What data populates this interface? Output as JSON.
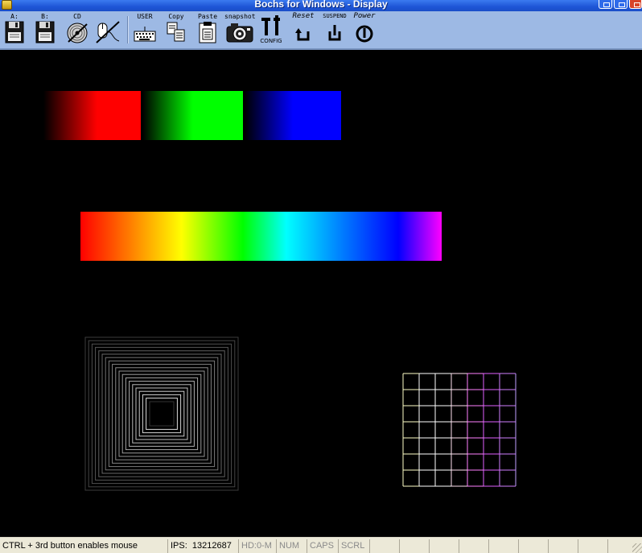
{
  "window": {
    "title": "Bochs for Windows - Display"
  },
  "toolbar": {
    "floppy_a": "A:",
    "floppy_b": "B:",
    "cdrom": "CD",
    "user": "USER",
    "copy": "Copy",
    "paste": "Paste",
    "snapshot": "snapshot",
    "config": "CONFIG",
    "reset": "Reset",
    "suspend": "SUSPEND",
    "power": "Power"
  },
  "display": {
    "fade_bars": [
      {
        "name": "red",
        "color": "#ff0000"
      },
      {
        "name": "green",
        "color": "#00ff00"
      },
      {
        "name": "blue",
        "color": "#0000ff"
      }
    ],
    "spectrum_colors": [
      "#ff0000",
      "#ffff00",
      "#00ff00",
      "#00ffff",
      "#0000ff",
      "#ff00ff"
    ],
    "grid": {
      "columns": 7,
      "rows": 7
    }
  },
  "statusbar": {
    "message": "CTRL + 3rd button enables mouse",
    "ips_label": "IPS:",
    "ips_value": "13212687",
    "hd": "HD:0-M",
    "num": "NUM",
    "caps": "CAPS",
    "scrl": "SCRL"
  }
}
